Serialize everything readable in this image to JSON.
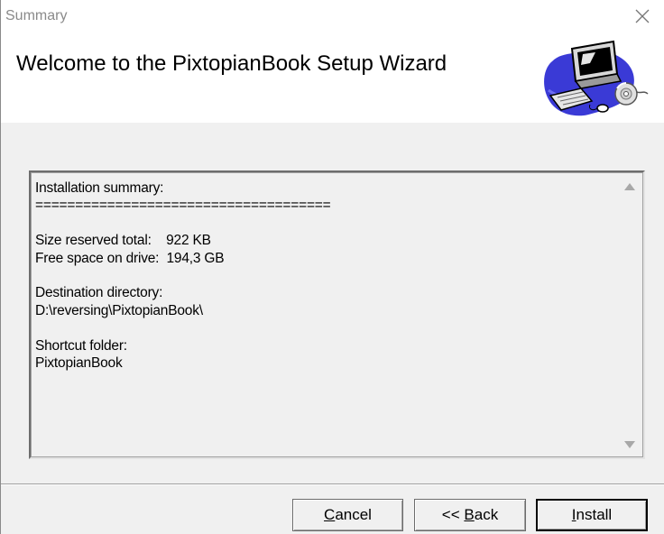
{
  "window": {
    "title": "Summary",
    "close_label": "Close"
  },
  "header": {
    "heading": "Welcome to the PixtopianBook Setup Wizard",
    "logo_icon": "computer-setup-icon"
  },
  "summary": {
    "text": "Installation summary:\n=====================================\n\nSize reserved total:    922 KB\nFree space on drive:  194,3 GB\n\nDestination directory:\nD:\\reversing\\PixtopianBook\\\n\nShortcut folder:\nPixtopianBook"
  },
  "buttons": {
    "cancel": {
      "mnemonic": "C",
      "rest": "ancel"
    },
    "back": {
      "prefix": "<< ",
      "mnemonic": "B",
      "rest": "ack"
    },
    "install": {
      "mnemonic": "I",
      "rest": "nstall"
    }
  },
  "colors": {
    "header_bg": "#ffffff",
    "window_bg": "#f0f0f0",
    "logo_blue": "#3a3ad6"
  }
}
